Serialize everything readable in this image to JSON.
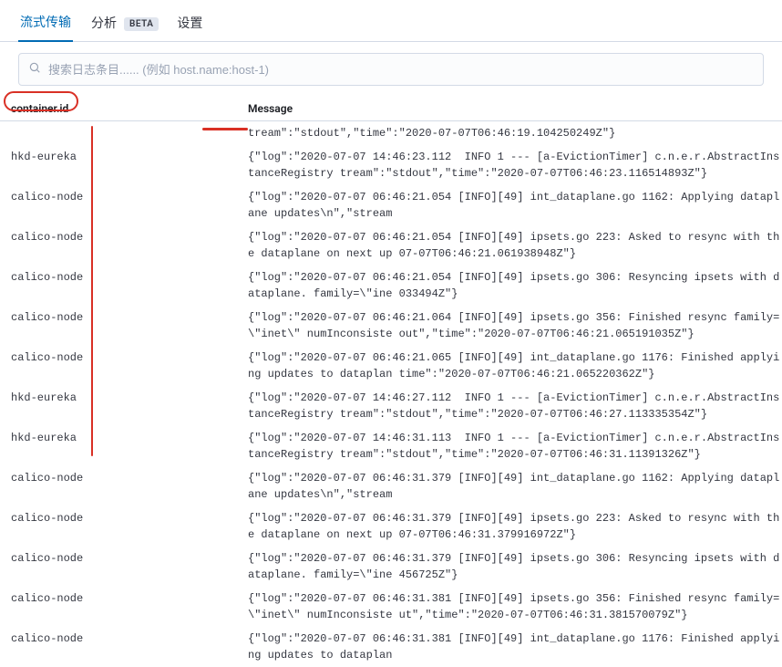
{
  "tabs": {
    "stream": "流式传输",
    "analysis": "分析",
    "beta": "BETA",
    "settings": "设置"
  },
  "search": {
    "placeholder": "搜索日志条目...... (例如 host.name:host-1)"
  },
  "headers": {
    "container": "container.id",
    "message": "Message"
  },
  "rows": [
    {
      "container": "",
      "message": "tream\":\"stdout\",\"time\":\"2020-07-07T06:46:19.104250249Z\"}"
    },
    {
      "container": "hkd-eureka",
      "message": "{\"log\":\"2020-07-07 14:46:23.112  INFO 1 --- [a-EvictionTimer] c.n.e.r.AbstractInstanceRegistry tream\":\"stdout\",\"time\":\"2020-07-07T06:46:23.116514893Z\"}"
    },
    {
      "container": "calico-node",
      "message": "{\"log\":\"2020-07-07 06:46:21.054 [INFO][49] int_dataplane.go 1162: Applying dataplane updates\\n\",\"stream"
    },
    {
      "container": "calico-node",
      "message": "{\"log\":\"2020-07-07 06:46:21.054 [INFO][49] ipsets.go 223: Asked to resync with the dataplane on next up 07-07T06:46:21.061938948Z\"}"
    },
    {
      "container": "calico-node",
      "message": "{\"log\":\"2020-07-07 06:46:21.054 [INFO][49] ipsets.go 306: Resyncing ipsets with dataplane. family=\\\"ine 033494Z\"}"
    },
    {
      "container": "calico-node",
      "message": "{\"log\":\"2020-07-07 06:46:21.064 [INFO][49] ipsets.go 356: Finished resync family=\\\"inet\\\" numInconsiste out\",\"time\":\"2020-07-07T06:46:21.065191035Z\"}"
    },
    {
      "container": "calico-node",
      "message": "{\"log\":\"2020-07-07 06:46:21.065 [INFO][49] int_dataplane.go 1176: Finished applying updates to dataplan time\":\"2020-07-07T06:46:21.065220362Z\"}"
    },
    {
      "container": "hkd-eureka",
      "message": "{\"log\":\"2020-07-07 14:46:27.112  INFO 1 --- [a-EvictionTimer] c.n.e.r.AbstractInstanceRegistry tream\":\"stdout\",\"time\":\"2020-07-07T06:46:27.113335354Z\"}"
    },
    {
      "container": "hkd-eureka",
      "message": "{\"log\":\"2020-07-07 14:46:31.113  INFO 1 --- [a-EvictionTimer] c.n.e.r.AbstractInstanceRegistry tream\":\"stdout\",\"time\":\"2020-07-07T06:46:31.11391326Z\"}"
    },
    {
      "container": "calico-node",
      "message": "{\"log\":\"2020-07-07 06:46:31.379 [INFO][49] int_dataplane.go 1162: Applying dataplane updates\\n\",\"stream"
    },
    {
      "container": "calico-node",
      "message": "{\"log\":\"2020-07-07 06:46:31.379 [INFO][49] ipsets.go 223: Asked to resync with the dataplane on next up 07-07T06:46:31.379916972Z\"}"
    },
    {
      "container": "calico-node",
      "message": "{\"log\":\"2020-07-07 06:46:31.379 [INFO][49] ipsets.go 306: Resyncing ipsets with dataplane. family=\\\"ine 456725Z\"}"
    },
    {
      "container": "calico-node",
      "message": "{\"log\":\"2020-07-07 06:46:31.381 [INFO][49] ipsets.go 356: Finished resync family=\\\"inet\\\" numInconsiste ut\",\"time\":\"2020-07-07T06:46:31.381570079Z\"}"
    },
    {
      "container": "calico-node",
      "message": "{\"log\":\"2020-07-07 06:46:31.381 [INFO][49] int_dataplane.go 1176: Finished applying updates to dataplan"
    }
  ]
}
